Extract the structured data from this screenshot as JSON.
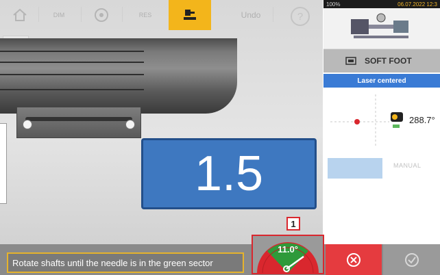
{
  "toolbar": {
    "home_icon": "home-icon",
    "dim_label": "DIM",
    "res_label": "RES",
    "undo_label": "Undo",
    "help_label": "?",
    "accent_color": "#f3b51b"
  },
  "measurement": {
    "value": "1.5"
  },
  "instruction": {
    "text": "Rotate shafts until the needle is in the green sector"
  },
  "gauge": {
    "angle": "11.0°",
    "badge": "1"
  },
  "status_bar": {
    "battery": "100%",
    "datetime": "06.07.2022 12:3"
  },
  "panel": {
    "title": "SOFT FOOT",
    "banner": "Laser centered",
    "angle": "288.7°",
    "manual_label": "MANUAL"
  },
  "colors": {
    "blue": "#3e78c0",
    "cancel": "#e53b3f",
    "gauge_green": "#2e9a3a",
    "gauge_red": "#d9272e"
  }
}
